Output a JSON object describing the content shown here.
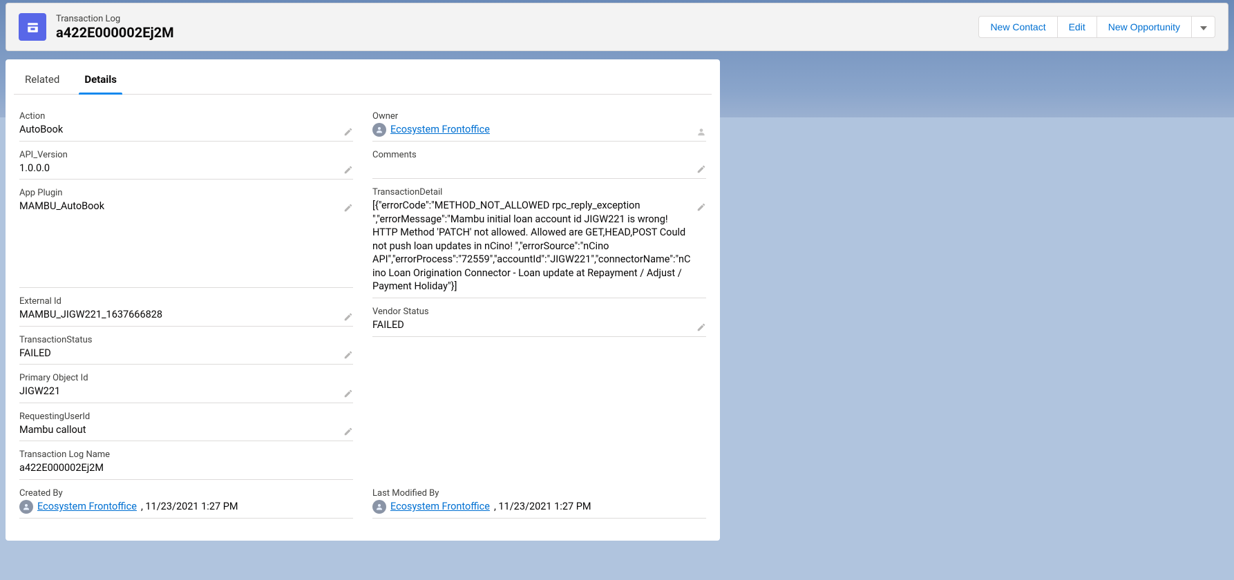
{
  "header": {
    "object_type": "Transaction Log",
    "record_name": "a422E000002Ej2M",
    "icon": "bag-icon",
    "actions": {
      "new_contact": "New Contact",
      "edit": "Edit",
      "new_opportunity": "New Opportunity"
    }
  },
  "tabs": {
    "related": "Related",
    "details": "Details",
    "active": "details"
  },
  "fields_left": {
    "action": {
      "label": "Action",
      "value": "AutoBook",
      "editable": true
    },
    "api_version": {
      "label": "API_Version",
      "value": "1.0.0.0",
      "editable": true
    },
    "app_plugin": {
      "label": "App Plugin",
      "value": "MAMBU_AutoBook",
      "editable": true
    },
    "external_id": {
      "label": "External Id",
      "value": "MAMBU_JIGW221_1637666828",
      "editable": true
    },
    "transaction_status": {
      "label": "TransactionStatus",
      "value": "FAILED",
      "editable": true
    },
    "primary_object_id": {
      "label": "Primary Object Id",
      "value": "JIGW221",
      "editable": true
    },
    "requesting_user_id": {
      "label": "RequestingUserId",
      "value": "Mambu callout",
      "editable": true
    },
    "txn_log_name": {
      "label": "Transaction Log Name",
      "value": "a422E000002Ej2M",
      "editable": false
    },
    "created_by": {
      "label": "Created By",
      "user": "Ecosystem Frontoffice",
      "timestamp": ", 11/23/2021 1:27 PM"
    }
  },
  "fields_right": {
    "owner": {
      "label": "Owner",
      "user": "Ecosystem Frontoffice"
    },
    "comments": {
      "label": "Comments",
      "value": "",
      "editable": true
    },
    "transaction_detail": {
      "label": "TransactionDetail",
      "value": "[{\"errorCode\":\"METHOD_NOT_ALLOWED rpc_reply_exception \",\"errorMessage\":\"Mambu initial loan account id JIGW221 is wrong! HTTP Method 'PATCH' not allowed. Allowed are GET,HEAD,POST Could not push loan updates in nCino! \",\"errorSource\":\"nCino API\",\"errorProcess\":\"72559\",\"accountId\":\"JIGW221\",\"connectorName\":\"nCino Loan Origination Connector - Loan update at Repayment / Adjust / Payment Holiday\"}]",
      "editable": true
    },
    "vendor_status": {
      "label": "Vendor Status",
      "value": "FAILED",
      "editable": true
    },
    "last_modified_by": {
      "label": "Last Modified By",
      "user": "Ecosystem Frontoffice",
      "timestamp": ", 11/23/2021 1:27 PM"
    }
  }
}
